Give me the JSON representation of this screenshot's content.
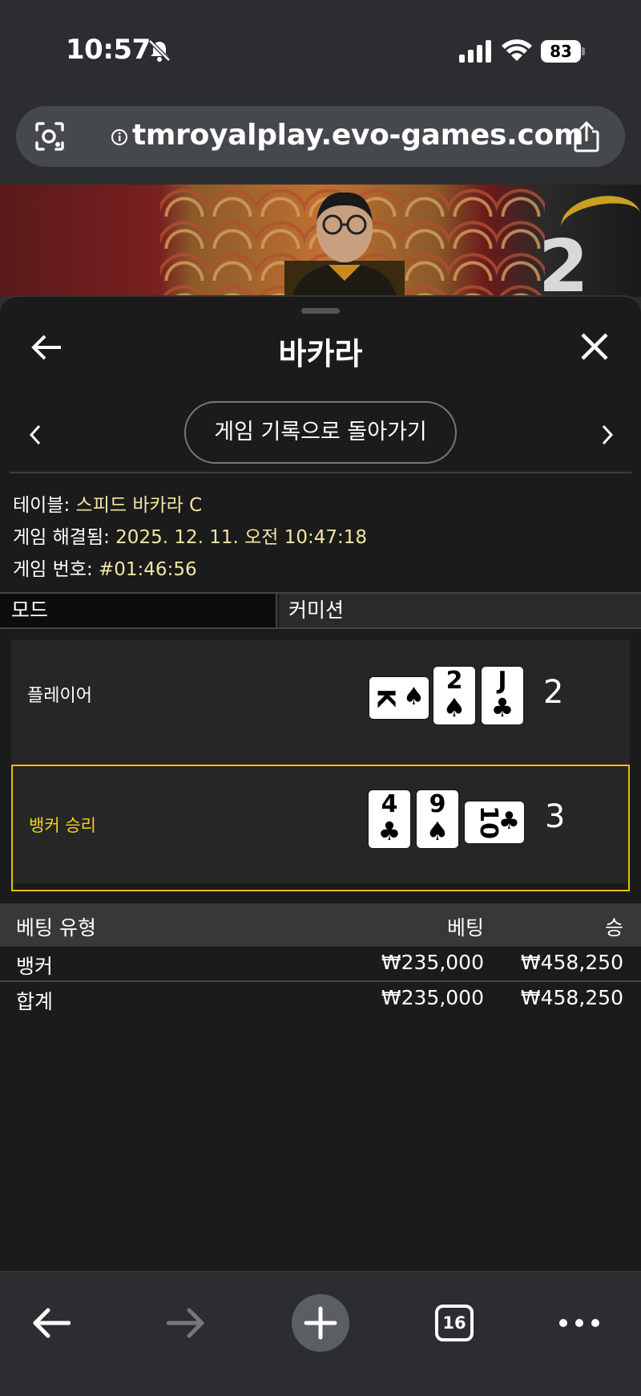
{
  "status": {
    "time": "10:57",
    "battery": "83"
  },
  "browser": {
    "url": "tmroyalplay.evo-games.com",
    "tab_count": "16"
  },
  "panel": {
    "title": "바카라",
    "back_history_label": "게임 기록으로 돌아가기"
  },
  "game_info": {
    "table_label": "테이블: ",
    "table_value": "스피드 바카라 C",
    "resolved_label": "게임 해결됨: ",
    "resolved_value": "2025. 12. 11. 오전 10:47:18",
    "number_label": "게임 번호: ",
    "number_value": "#01:46:56"
  },
  "mode": {
    "label": "모드",
    "value": "커미션"
  },
  "result": {
    "player": {
      "label": "플레이어",
      "score": "2",
      "cards": [
        {
          "rank": "K",
          "suit": "♠",
          "orientation": "side"
        },
        {
          "rank": "2",
          "suit": "♠",
          "orientation": "up"
        },
        {
          "rank": "J",
          "suit": "♣",
          "orientation": "up"
        }
      ]
    },
    "banker": {
      "label": "뱅커 승리",
      "score": "3",
      "cards": [
        {
          "rank": "4",
          "suit": "♣",
          "orientation": "up"
        },
        {
          "rank": "9",
          "suit": "♠",
          "orientation": "up"
        },
        {
          "rank": "10",
          "suit": "♣",
          "orientation": "side"
        }
      ]
    }
  },
  "bets": {
    "headers": {
      "type": "베팅 유형",
      "bet": "베팅",
      "win": "승"
    },
    "rows": [
      {
        "type": "뱅커",
        "bet": "₩235,000",
        "win": "₩458,250"
      }
    ],
    "total": {
      "type": "합계",
      "bet": "₩235,000",
      "win": "₩458,250"
    }
  },
  "colors": {
    "highlight": "#e5c200",
    "info_value": "#f3e6a6",
    "panel_bg": "#1b1b1b"
  }
}
